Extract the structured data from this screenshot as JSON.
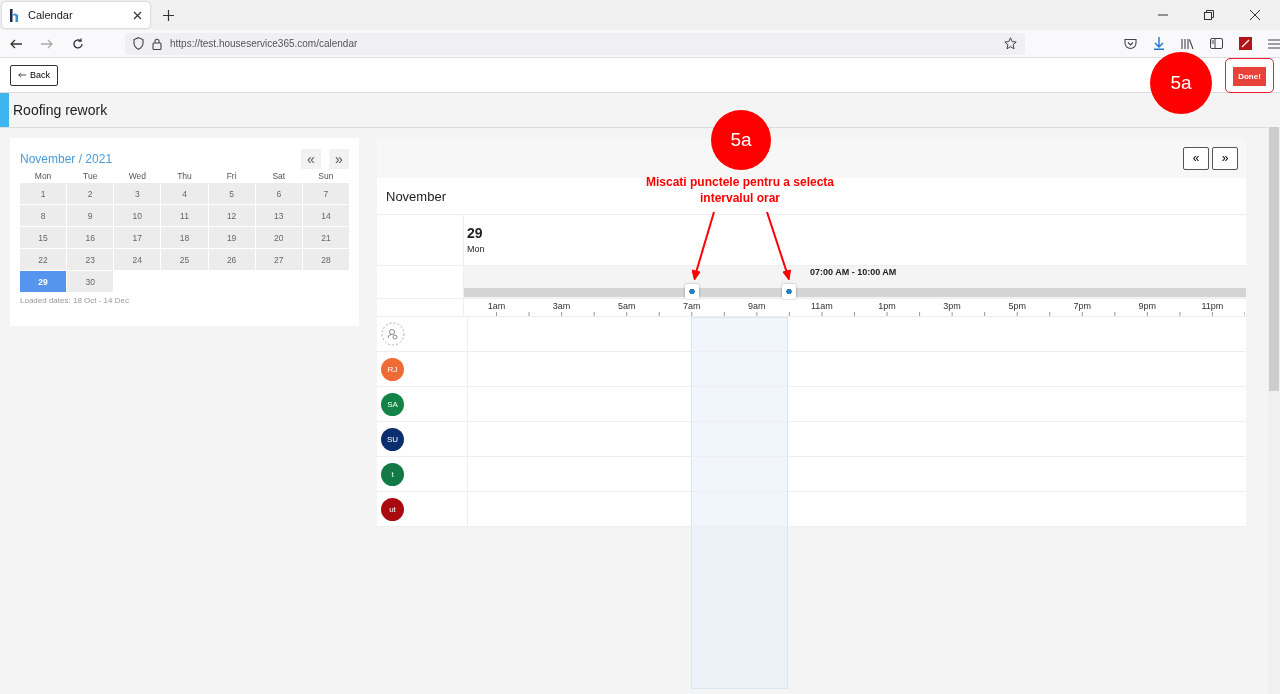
{
  "browser": {
    "tab_title": "Calendar",
    "url": "https://test.houseservice365.com/calendar"
  },
  "app_bar": {
    "back_label": "Back",
    "done_label": "Done!"
  },
  "page_title": "Roofing rework",
  "mini_calendar": {
    "title": "November / 2021",
    "prev": "«",
    "next": "»",
    "weekdays": [
      "Mon",
      "Tue",
      "Wed",
      "Thu",
      "Fri",
      "Sat",
      "Sun"
    ],
    "days": [
      {
        "label": "1",
        "selected": false
      },
      {
        "label": "2",
        "selected": false
      },
      {
        "label": "3",
        "selected": false
      },
      {
        "label": "4",
        "selected": false
      },
      {
        "label": "5",
        "selected": false
      },
      {
        "label": "6",
        "selected": false
      },
      {
        "label": "7",
        "selected": false
      },
      {
        "label": "8",
        "selected": false
      },
      {
        "label": "9",
        "selected": false
      },
      {
        "label": "10",
        "selected": false
      },
      {
        "label": "11",
        "selected": false
      },
      {
        "label": "12",
        "selected": false
      },
      {
        "label": "13",
        "selected": false
      },
      {
        "label": "14",
        "selected": false
      },
      {
        "label": "15",
        "selected": false
      },
      {
        "label": "16",
        "selected": false
      },
      {
        "label": "17",
        "selected": false
      },
      {
        "label": "18",
        "selected": false
      },
      {
        "label": "19",
        "selected": false
      },
      {
        "label": "20",
        "selected": false
      },
      {
        "label": "21",
        "selected": false
      },
      {
        "label": "22",
        "selected": false
      },
      {
        "label": "23",
        "selected": false
      },
      {
        "label": "24",
        "selected": false
      },
      {
        "label": "25",
        "selected": false
      },
      {
        "label": "26",
        "selected": false
      },
      {
        "label": "27",
        "selected": false
      },
      {
        "label": "28",
        "selected": false
      },
      {
        "label": "29",
        "selected": true
      },
      {
        "label": "30",
        "selected": false
      }
    ],
    "loaded_dates": "Loaded dates: 18 Oct - 14 Dec"
  },
  "schedule": {
    "prev": "«",
    "next": "»",
    "month": "November",
    "day_number": "29",
    "day_name": "Mon",
    "range_label": "07:00 AM - 10:00 AM",
    "handles": [
      {
        "level": 0.2917
      },
      {
        "level": 0.4167
      }
    ],
    "hour_labels": [
      "1am",
      "3am",
      "5am",
      "7am",
      "9am",
      "11am",
      "1pm",
      "3pm",
      "5pm",
      "7pm",
      "9pm",
      "11pm"
    ],
    "resources": [
      {
        "kind": "unassigned"
      },
      {
        "kind": "avatar",
        "initials": "RJ",
        "color": "#f06a35"
      },
      {
        "kind": "avatar",
        "initials": "SA",
        "color": "#128246"
      },
      {
        "kind": "avatar",
        "initials": "SU",
        "color": "#0b2f6e"
      },
      {
        "kind": "avatar",
        "initials": "t",
        "color": "#137a45"
      },
      {
        "kind": "avatar",
        "initials": "ut",
        "color": "#a80a10"
      }
    ]
  },
  "annotations": [
    {
      "kind": "badge",
      "text": "5a"
    },
    {
      "kind": "callout",
      "text": "5a",
      "note": "Miscati punctele pentru a selecta intervalul orar"
    }
  ]
}
